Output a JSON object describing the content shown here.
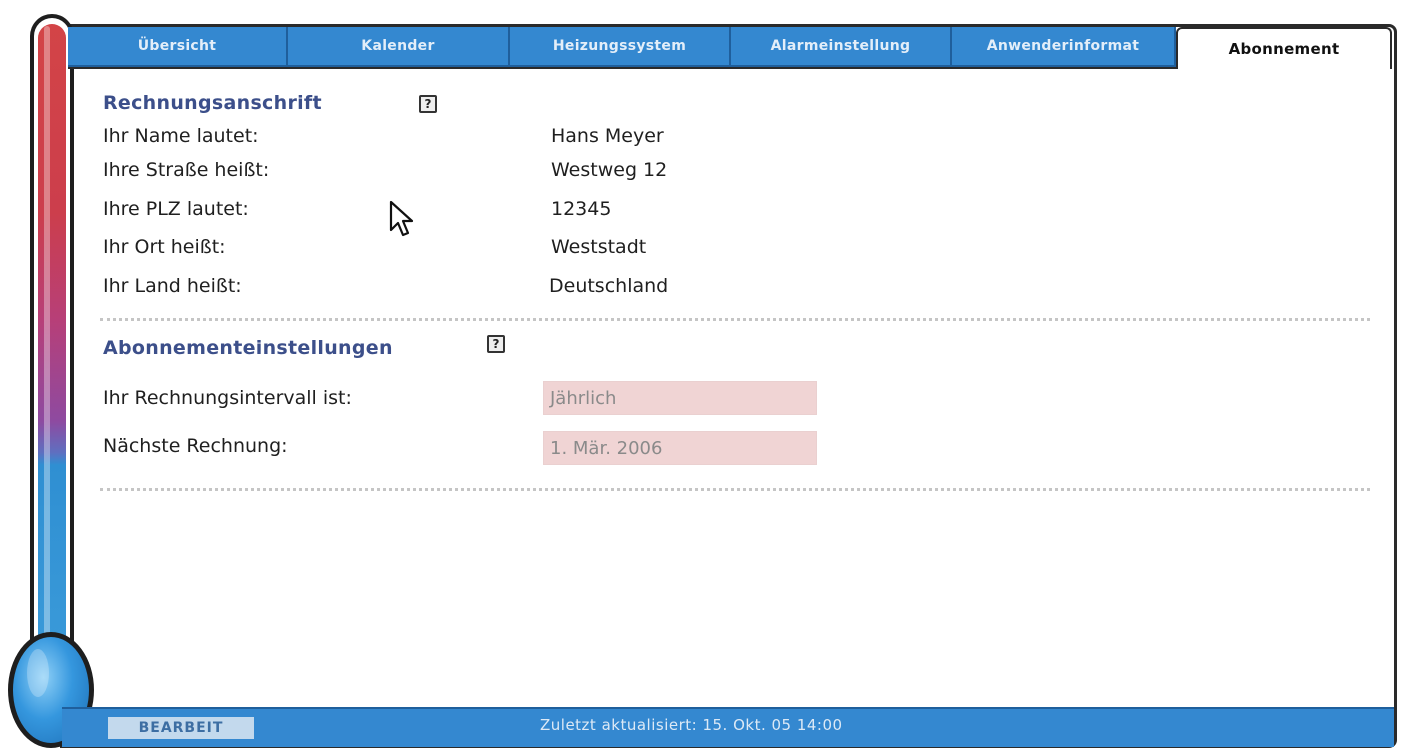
{
  "tabs": [
    {
      "label": "Übersicht"
    },
    {
      "label": "Kalender"
    },
    {
      "label": "Heizungssystem"
    },
    {
      "label": "Alarmeinstellung"
    },
    {
      "label": "Anwenderinformat"
    },
    {
      "label": "Abonnement"
    }
  ],
  "active_tab": "Abonnement",
  "billing": {
    "title": "Rechnungsanschrift",
    "help": "?",
    "rows": [
      {
        "label": "Ihr Name lautet:",
        "value": "Hans Meyer"
      },
      {
        "label": "Ihre Straße heißt:",
        "value": "Westweg 12"
      },
      {
        "label": "Ihre PLZ lautet:",
        "value": "12345"
      },
      {
        "label": "Ihr Ort heißt:",
        "value": "Weststadt"
      },
      {
        "label": "Ihr Land heißt:",
        "value": "Deutschland"
      }
    ]
  },
  "subscription": {
    "title": "Abonnementeinstellungen",
    "help": "?",
    "rows": [
      {
        "label": "Ihr Rechnungsintervall ist:",
        "value": "Jährlich"
      },
      {
        "label": "Nächste Rechnung:",
        "value": "1. Mär. 2006"
      }
    ]
  },
  "footer": {
    "edit_label": "BEARBEIT",
    "status": "Zuletzt aktualisiert: 15. Okt. 05 14:00"
  },
  "colors": {
    "tab_blue": "#3488d0",
    "section_title": "#3c4f8a",
    "field_bg": "#f0d4d4"
  }
}
